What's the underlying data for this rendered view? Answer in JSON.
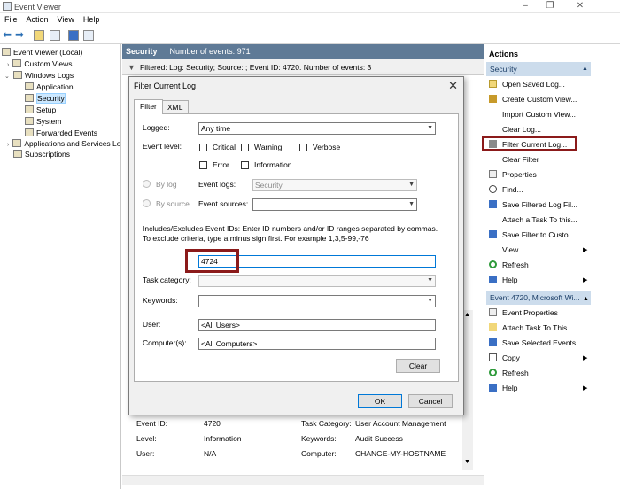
{
  "window": {
    "title": "Event Viewer"
  },
  "menu": [
    "File",
    "Action",
    "View",
    "Help"
  ],
  "tree": {
    "root": "Event Viewer (Local)",
    "custom_views": "Custom Views",
    "windows_logs": "Windows Logs",
    "application": "Application",
    "security": "Security",
    "setup": "Setup",
    "system": "System",
    "forwarded": "Forwarded Events",
    "apps_services": "Applications and Services Lo",
    "subscriptions": "Subscriptions"
  },
  "center": {
    "header_name": "Security",
    "header_count": "Number of events: 971",
    "filter_text": "Filtered: Log: Security; Source: ; Event ID: 4720. Number of events: 3"
  },
  "details": {
    "event_id_label": "Event ID:",
    "event_id": "4720",
    "task_label": "Task Category:",
    "task": "User Account Management",
    "level_label": "Level:",
    "level": "Information",
    "keywords_label": "Keywords:",
    "keywords": "Audit Success",
    "user_label": "User:",
    "user": "N/A",
    "computer_label": "Computer:",
    "computer": "CHANGE-MY-HOSTNAME"
  },
  "dialog": {
    "title": "Filter Current Log",
    "close": "✕",
    "tab_filter": "Filter",
    "tab_xml": "XML",
    "logged_label": "Logged:",
    "logged_value": "Any time",
    "level_label": "Event level:",
    "critical": "Critical",
    "warning": "Warning",
    "verbose": "Verbose",
    "error": "Error",
    "information": "Information",
    "by_log": "By log",
    "by_source": "By source",
    "event_logs_label": "Event logs:",
    "event_logs_value": "Security",
    "event_sources_label": "Event sources:",
    "instructions": "Includes/Excludes Event IDs: Enter ID numbers and/or ID ranges separated by commas. To exclude criteria, type a minus sign first. For example 1,3,5-99,-76",
    "event_id_value": "4724",
    "task_label": "Task category:",
    "keywords_label": "Keywords:",
    "user_label": "User:",
    "user_value": "<All Users>",
    "computer_label": "Computer(s):",
    "computer_value": "<All Computers>",
    "clear": "Clear",
    "ok": "OK",
    "cancel": "Cancel"
  },
  "actions": {
    "title": "Actions",
    "section1": "Security",
    "items1": [
      "Open Saved Log...",
      "Create Custom View...",
      "Import Custom View...",
      "Clear Log...",
      "Filter Current Log...",
      "Clear Filter",
      "Properties",
      "Find...",
      "Save Filtered Log Fil...",
      "Attach a Task To this...",
      "Save Filter to Custo...",
      "View",
      "Refresh",
      "Help"
    ],
    "section2": "Event 4720, Microsoft Wi...",
    "items2": [
      "Event Properties",
      "Attach Task To This ...",
      "Save Selected Events...",
      "Copy",
      "Refresh",
      "Help"
    ]
  },
  "colors": {
    "accent": "#5f7a96",
    "highlight": "#8b1a1a",
    "section": "#ccdcec"
  }
}
